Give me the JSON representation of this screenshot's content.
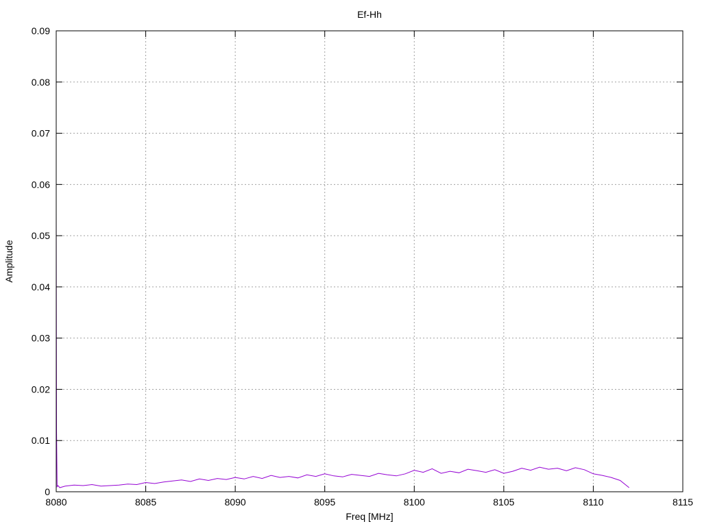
{
  "chart_data": {
    "type": "line",
    "title": "Ef-Hh",
    "xlabel": "Freq [MHz]",
    "ylabel": "Amplitude",
    "xlim": [
      8080,
      8115
    ],
    "ylim": [
      0,
      0.09
    ],
    "xticks": [
      8080,
      8085,
      8090,
      8095,
      8100,
      8105,
      8110,
      8115
    ],
    "yticks": [
      0,
      0.01,
      0.02,
      0.03,
      0.04,
      0.05,
      0.06,
      0.07,
      0.08,
      0.09
    ],
    "xtick_labels": [
      "8080",
      "8085",
      "8090",
      "8095",
      "8100",
      "8105",
      "8110",
      "8115"
    ],
    "ytick_labels": [
      "0",
      "0.01",
      "0.02",
      "0.03",
      "0.04",
      "0.05",
      "0.06",
      "0.07",
      "0.08",
      "0.09"
    ],
    "grid": true,
    "series_color": "#9400d3",
    "series": [
      {
        "x": [
          8080.0,
          8080.02,
          8080.05,
          8080.1,
          8080.2,
          8080.5,
          8081.0,
          8081.5,
          8082.0,
          8082.5,
          8083.0,
          8083.5,
          8084.0,
          8084.5,
          8085.0,
          8085.5,
          8086.0,
          8086.5,
          8087.0,
          8087.5,
          8088.0,
          8088.5,
          8089.0,
          8089.5,
          8090.0,
          8090.5,
          8091.0,
          8091.5,
          8092.0,
          8092.5,
          8093.0,
          8093.5,
          8094.0,
          8094.5,
          8095.0,
          8095.5,
          8096.0,
          8096.5,
          8097.0,
          8097.5,
          8098.0,
          8098.5,
          8099.0,
          8099.5,
          8100.0,
          8100.5,
          8101.0,
          8101.5,
          8102.0,
          8102.5,
          8103.0,
          8103.5,
          8104.0,
          8104.5,
          8105.0,
          8105.5,
          8106.0,
          8106.5,
          8107.0,
          8107.5,
          8108.0,
          8108.5,
          8109.0,
          8109.5,
          8110.0,
          8110.5,
          8111.0,
          8111.5,
          8112.0
        ],
        "y": [
          0.0545,
          0.012,
          0.001,
          0.0012,
          0.0008,
          0.0011,
          0.0013,
          0.0012,
          0.0014,
          0.0011,
          0.0012,
          0.0013,
          0.0015,
          0.0014,
          0.0018,
          0.0016,
          0.0019,
          0.0021,
          0.0023,
          0.002,
          0.0025,
          0.0022,
          0.0026,
          0.0024,
          0.0028,
          0.0025,
          0.003,
          0.0026,
          0.0032,
          0.0028,
          0.003,
          0.0027,
          0.0033,
          0.003,
          0.0035,
          0.0031,
          0.0029,
          0.0034,
          0.0032,
          0.003,
          0.0036,
          0.0033,
          0.0031,
          0.0035,
          0.0042,
          0.0038,
          0.0045,
          0.0036,
          0.004,
          0.0037,
          0.0044,
          0.0041,
          0.0038,
          0.0043,
          0.0036,
          0.004,
          0.0046,
          0.0042,
          0.0048,
          0.0044,
          0.0046,
          0.0041,
          0.0047,
          0.0043,
          0.0035,
          0.0032,
          0.0028,
          0.0022,
          0.0008
        ]
      }
    ]
  }
}
